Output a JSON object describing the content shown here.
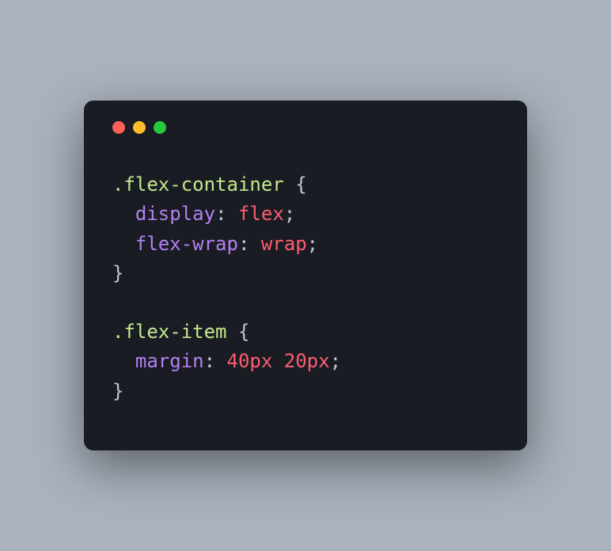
{
  "code": {
    "rule1": {
      "selector": ".flex-container",
      "open": " {",
      "decl1": {
        "indent": "  ",
        "prop": "display",
        "colon": ": ",
        "val": "flex",
        "semi": ";"
      },
      "decl2": {
        "indent": "  ",
        "prop": "flex-wrap",
        "colon": ": ",
        "val": "wrap",
        "semi": ";"
      },
      "close": "}"
    },
    "blank": "",
    "rule2": {
      "selector": ".flex-item",
      "open": " {",
      "decl1": {
        "indent": "  ",
        "prop": "margin",
        "colon": ": ",
        "val": "40px 20px",
        "semi": ";"
      },
      "close": "}"
    }
  }
}
